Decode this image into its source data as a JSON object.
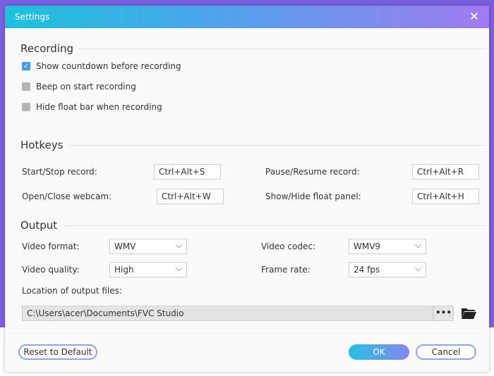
{
  "title": "Settings",
  "recording": {
    "heading": "Recording",
    "options": [
      {
        "label": "Show countdown before recording",
        "checked": true
      },
      {
        "label": "Beep on start recording",
        "checked": false
      },
      {
        "label": "Hide float bar when recording",
        "checked": false
      }
    ]
  },
  "hotkeys": {
    "heading": "Hotkeys",
    "start_stop": {
      "label": "Start/Stop record:",
      "value": "Ctrl+Alt+S"
    },
    "pause_resume": {
      "label": "Pause/Resume record:",
      "value": "Ctrl+Alt+R"
    },
    "webcam": {
      "label": "Open/Close webcam:",
      "value": "Ctrl+Alt+W"
    },
    "float_panel": {
      "label": "Show/Hide float panel:",
      "value": "Ctrl+Alt+H"
    }
  },
  "output": {
    "heading": "Output",
    "video_format": {
      "label": "Video format:",
      "value": "WMV"
    },
    "video_codec": {
      "label": "Video codec:",
      "value": "WMV9"
    },
    "video_quality": {
      "label": "Video quality:",
      "value": "High"
    },
    "frame_rate": {
      "label": "Frame rate:",
      "value": "24 fps"
    },
    "location_label": "Location of output files:",
    "location": "C:\\Users\\acer\\Documents\\FVC Studio",
    "browse": "•••"
  },
  "buttons": {
    "reset": "Reset to Default",
    "ok": "OK",
    "cancel": "Cancel"
  },
  "colors": {
    "accent": "#3d9be9",
    "title_start": "#1cc2dc",
    "title_end": "#a27bf2"
  }
}
